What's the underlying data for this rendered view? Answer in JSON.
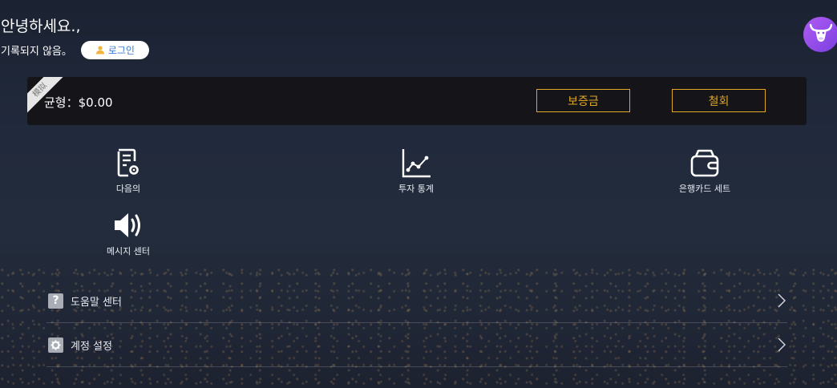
{
  "header": {
    "greeting": "안녕하세요.,",
    "not_logged_in": "기록되지 않음。",
    "login_label": "로그인"
  },
  "balance_card": {
    "ribbon": "模拟",
    "balance_label": "균형：",
    "balance_value": "$0.00",
    "deposit_label": "보증금",
    "withdraw_label": "철회"
  },
  "menu": [
    {
      "label": "다음의",
      "icon": "order-settings-icon"
    },
    {
      "label": "투자 통계",
      "icon": "line-chart-icon"
    },
    {
      "label": "은행카드 세트",
      "icon": "wallet-icon"
    },
    {
      "label": "메시지 센터",
      "icon": "speaker-icon"
    }
  ],
  "list": [
    {
      "label": "도움말 센터",
      "icon": "question-icon",
      "glyph": "?"
    },
    {
      "label": "계정 설정",
      "icon": "gear-icon"
    }
  ],
  "colors": {
    "accent_gold": "#e0a826",
    "login_text": "#3b79d6",
    "avatar_purple": "#a24ff0"
  }
}
